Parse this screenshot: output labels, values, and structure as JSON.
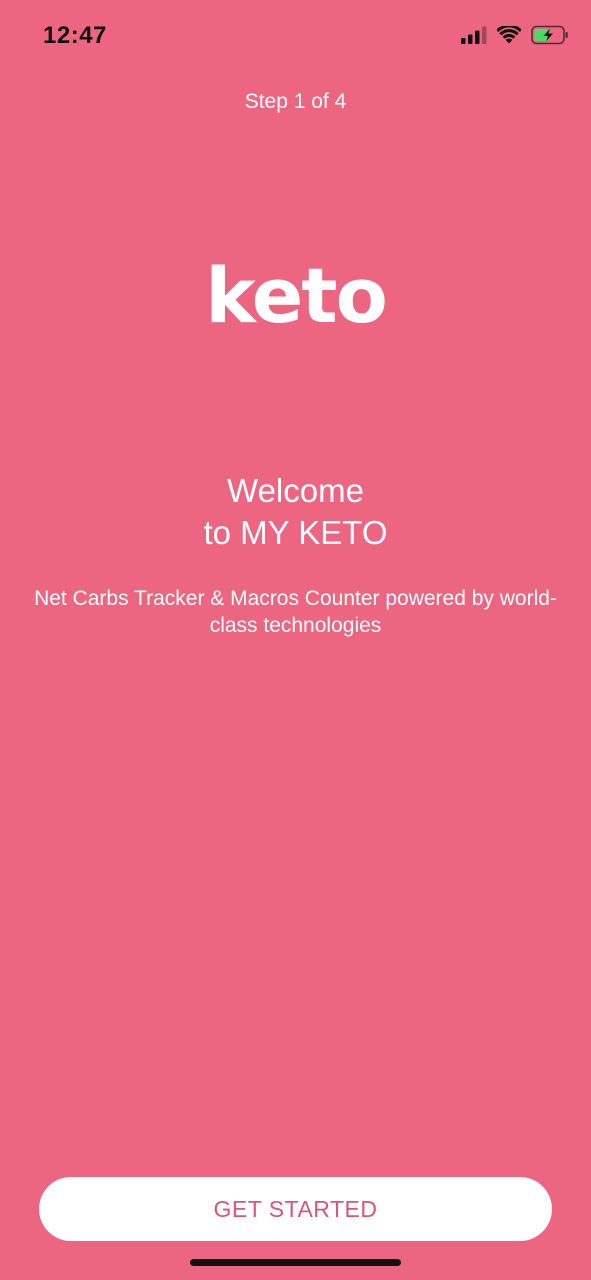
{
  "status_bar": {
    "time": "12:47",
    "icons": [
      "cellular-signal-icon",
      "wifi-icon",
      "battery-charging-icon"
    ],
    "battery_fill_color": "#4cd964"
  },
  "onboarding": {
    "step_label": "Step 1 of 4",
    "logo_text": "keto",
    "welcome_line1": "Welcome",
    "welcome_line2": "to MY KETO",
    "subtitle": "Net Carbs Tracker & Macros Counter powered by world-class technologies",
    "cta_label": "GET STARTED"
  },
  "colors": {
    "background": "#ec6682",
    "cta_text": "#d9557a",
    "cta_background": "#ffffff"
  }
}
